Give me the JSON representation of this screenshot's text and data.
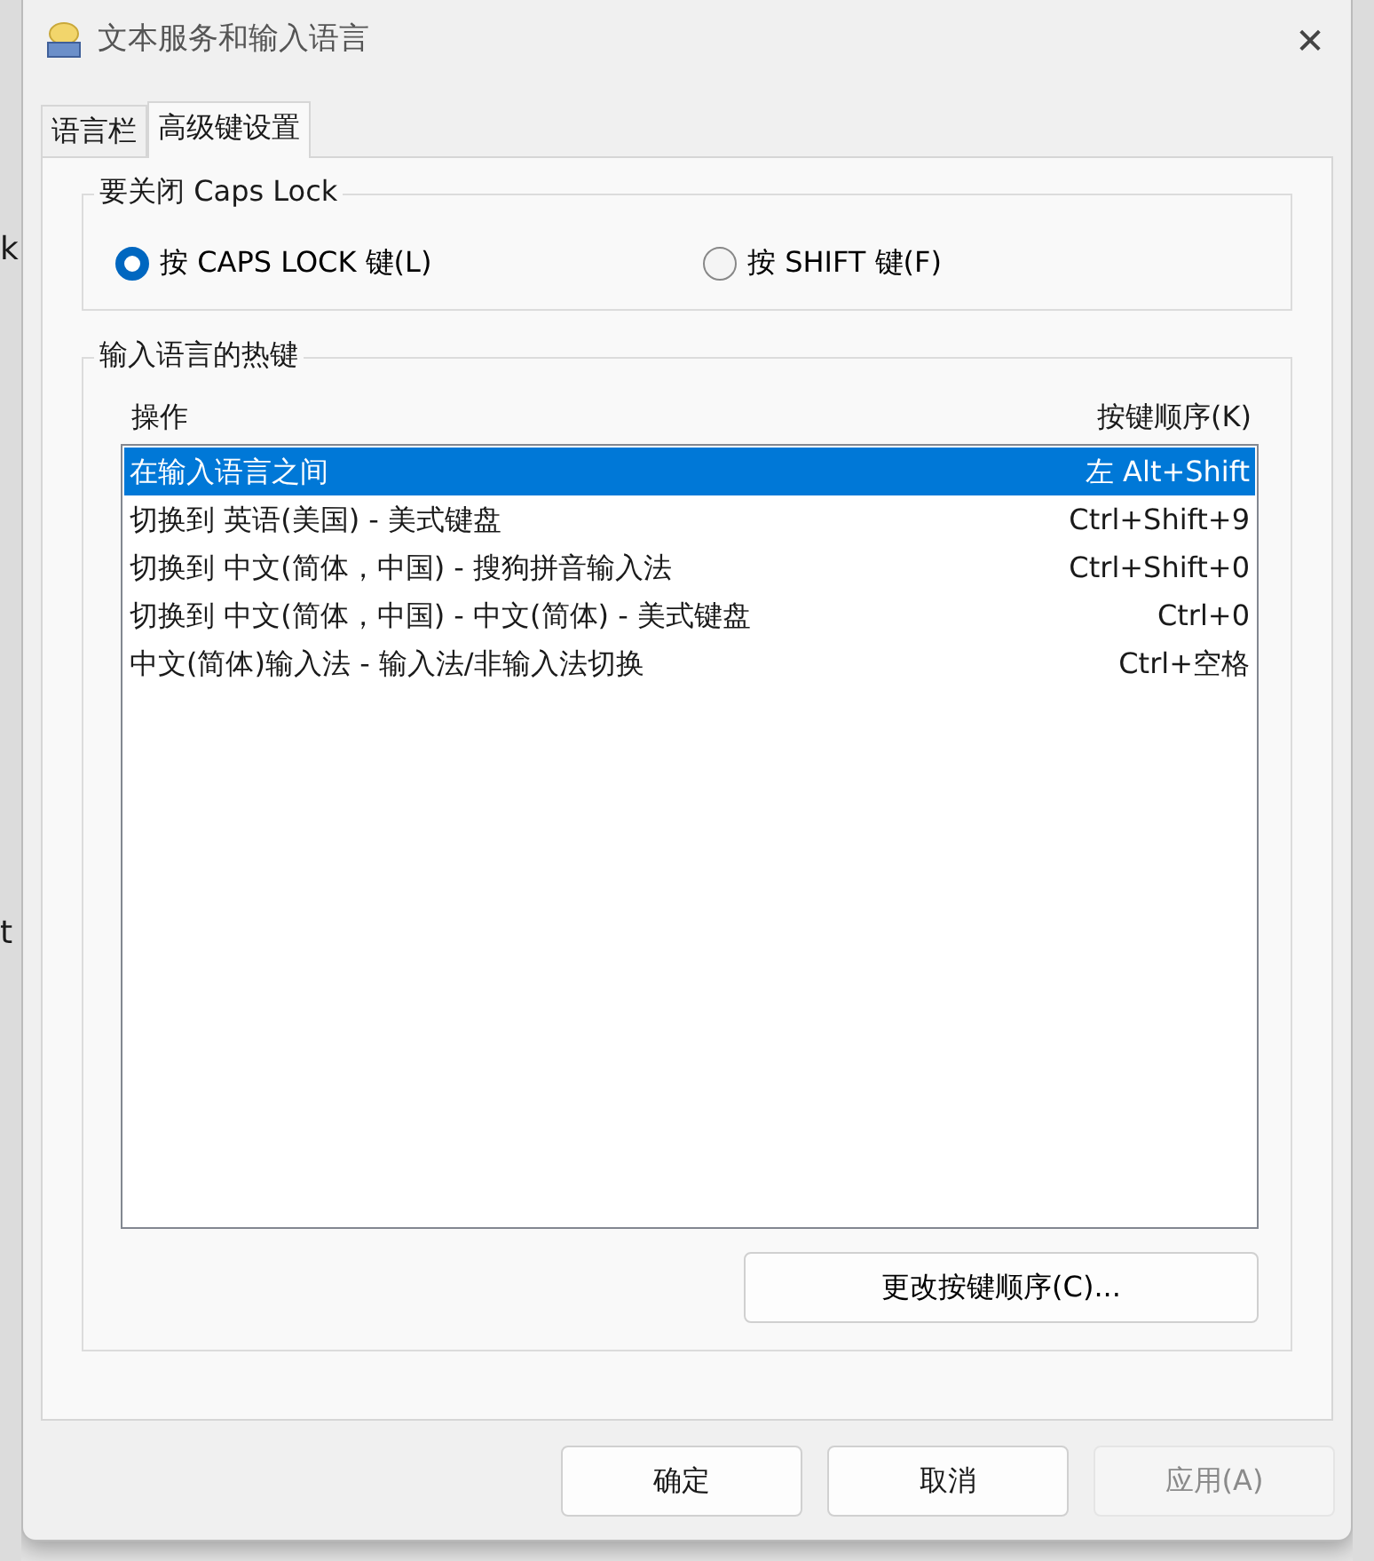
{
  "background": {
    "fragments": [
      {
        "text": "k"
      },
      {
        "text": "t"
      }
    ]
  },
  "window": {
    "title": "文本服务和输入语言",
    "close": "✕"
  },
  "tabs": [
    {
      "label": "语言栏",
      "selected": false
    },
    {
      "label": "高级键设置",
      "selected": true
    }
  ],
  "caps_lock_group": {
    "title": "要关闭 Caps Lock",
    "options": [
      {
        "label": "按 CAPS LOCK 键(L)",
        "selected": true
      },
      {
        "label": "按 SHIFT 键(F)",
        "selected": false
      }
    ]
  },
  "hotkeys_group": {
    "title": "输入语言的热键",
    "columns": [
      "操作",
      "按键顺序(K)"
    ],
    "rows": [
      {
        "action": "在输入语言之间",
        "keys": "左 Alt+Shift",
        "selected": true
      },
      {
        "action": "切换到 英语(美国) - 美式键盘",
        "keys": "Ctrl+Shift+9",
        "selected": false
      },
      {
        "action": "切换到 中文(简体，中国) - 搜狗拼音输入法",
        "keys": "Ctrl+Shift+0",
        "selected": false
      },
      {
        "action": "切换到 中文(简体，中国) - 中文(简体) - 美式键盘",
        "keys": "Ctrl+0",
        "selected": false
      },
      {
        "action": "中文(简体)输入法 - 输入法/非输入法切换",
        "keys": "Ctrl+空格",
        "selected": false
      }
    ],
    "change_button": "更改按键顺序(C)..."
  },
  "buttons": [
    {
      "label": "确定",
      "disabled": false
    },
    {
      "label": "取消",
      "disabled": false
    },
    {
      "label": "应用(A)",
      "disabled": true
    }
  ]
}
